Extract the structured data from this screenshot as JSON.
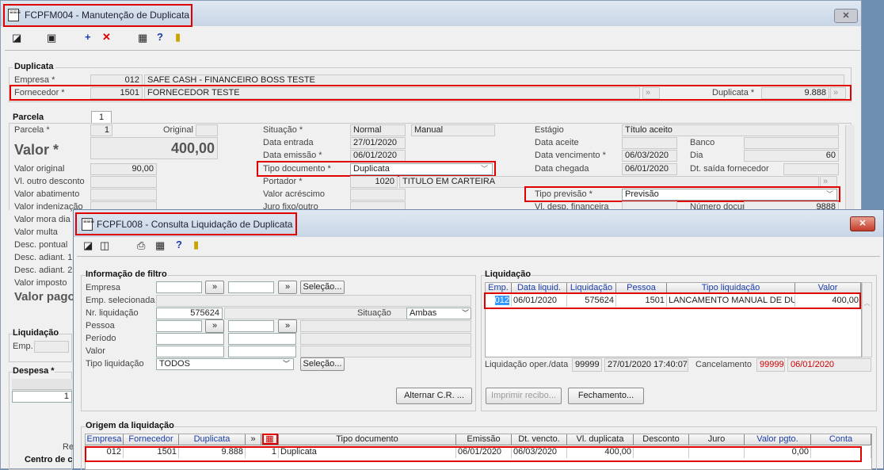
{
  "main": {
    "title": "FCPFM004 - Manutenção de Duplicata",
    "duplicata_section": "Duplicata",
    "empresa_label": "Empresa *",
    "empresa_code": "012",
    "empresa_name": "SAFE CASH - FINANCEIRO BOSS TESTE",
    "fornecedor_label": "Fornecedor *",
    "fornecedor_code": "1501",
    "fornecedor_name": "FORNECEDOR TESTE",
    "duplicata_label": "Duplicata *",
    "duplicata_value": "9.888",
    "parcela_tab": "1",
    "parcela_section": "Parcela",
    "parcela_label": "Parcela *",
    "parcela_value": "1",
    "original_label": "Original",
    "valor_label": "Valor *",
    "valor_value": "400,00",
    "valor_original_label": "Valor original",
    "valor_original_value": "90,00",
    "left_labels": [
      "Vl. outro desconto",
      "Valor abatimento",
      "Valor indenização",
      "Valor mora dia",
      "Valor multa",
      "Desc. pontual",
      "Desc. adiant. 1",
      "Desc. adiant. 2",
      "Valor imposto"
    ],
    "valor_pago_label": "Valor pago",
    "liquidacao_section": "Liquidação",
    "emp_label": "Emp.",
    "despesa_section": "Despesa *",
    "despesa_value": "1",
    "re_label": "Re",
    "centro_label": "Centro de c",
    "situacao_label": "Situação *",
    "situacao_value": "Normal",
    "situacao_tipo": "Manual",
    "data_entrada_label": "Data entrada",
    "data_entrada_value": "27/01/2020",
    "data_emissao_label": "Data emissão *",
    "data_emissao_value": "06/01/2020",
    "tipo_doc_label": "Tipo documento *",
    "tipo_doc_value": "Duplicata",
    "portador_label": "Portador *",
    "portador_code": "1020",
    "portador_name": "TITULO EM CARTEIRA",
    "valor_acrescimo_label": "Valor acréscimo",
    "juro_fixo_label": "Juro fixo/outro",
    "estagio_label": "Estágio",
    "estagio_value": "Título aceito",
    "data_aceite_label": "Data aceite",
    "banco_label": "Banco",
    "data_venc_label": "Data vencimento *",
    "data_venc_value": "06/03/2020",
    "dia_label": "Dia",
    "dia_value": "60",
    "data_chegada_label": "Data chegada",
    "data_chegada_value": "06/01/2020",
    "dt_saida_label": "Dt. saída fornecedor",
    "tipo_previsao_label": "Tipo previsão *",
    "tipo_previsao_value": "Previsão",
    "vl_desp_label": "Vl. desp. financeira",
    "num_doc_label": "Número documento",
    "num_doc_value": "9888"
  },
  "dialog": {
    "title": "FCPFL008 - Consulta Liquidação de Duplicata",
    "filtro_section": "Informação de filtro",
    "empresa_label": "Empresa",
    "emp_sel_label": "Emp. selecionada",
    "nr_liq_label": "Nr. liquidação",
    "nr_liq_value": "575624",
    "situacao_label": "Situação",
    "situacao_value": "Ambas",
    "pessoa_label": "Pessoa",
    "periodo_label": "Período",
    "valor_label": "Valor",
    "tipo_liq_label": "Tipo liquidação",
    "tipo_liq_value": "TODOS",
    "selecao_label": "Seleção...",
    "alternar_label": "Alternar C.R. ...",
    "liquidacao_section": "Liquidação",
    "liq_columns": [
      "Emp.",
      "Data liquid.",
      "Liquidação",
      "Pessoa",
      "Tipo liquidação",
      "Valor"
    ],
    "liq_rows": [
      [
        "012",
        "06/01/2020",
        "575624",
        "1501",
        "LANCAMENTO MANUAL DE DUF",
        "400,00"
      ]
    ],
    "liq_oper_label": "Liquidação oper./data",
    "liq_oper_code": "99999",
    "liq_oper_datetime": "27/01/2020 17:40:07",
    "cancelamento_label": "Cancelamento",
    "cancel_code": "99999",
    "cancel_date": "06/01/2020",
    "imprimir_label": "Imprimir recibo...",
    "fechamento_label": "Fechamento...",
    "origem_section": "Origem da liquidação",
    "orig_columns": [
      "Empresa",
      "Fornecedor",
      "Duplicata",
      "»",
      "",
      "Tipo documento",
      "Emissão",
      "Dt. vencto.",
      "Vl. duplicata",
      "Desconto",
      "Juro",
      "Valor pgto.",
      "Conta"
    ],
    "orig_rows": [
      [
        "012",
        "1501",
        "9.888",
        "",
        "1",
        "Duplicata",
        "06/01/2020",
        "06/03/2020",
        "400,00",
        "",
        "",
        "0,00",
        ""
      ]
    ]
  },
  "colors": {
    "accent": "#e00000",
    "header_text": "#1a3caa",
    "selection": "#3399ff",
    "cancel_text": "#d00000"
  }
}
